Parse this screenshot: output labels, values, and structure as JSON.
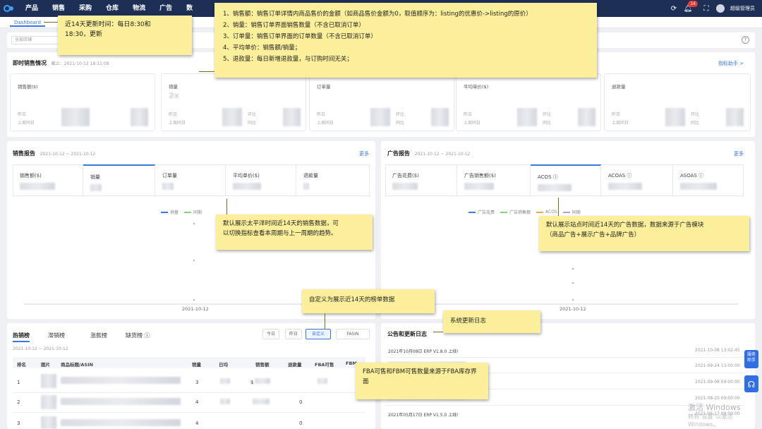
{
  "nav": {
    "items": [
      "产品",
      "销售",
      "采购",
      "仓库",
      "物流",
      "广告",
      "数"
    ],
    "badge": "14",
    "user": "超级管理员"
  },
  "tabbar": {
    "dashboard": "Dashboard"
  },
  "filter": {
    "store_placeholder": "全部店铺"
  },
  "realtime": {
    "title": "即时销售情况",
    "subtitle": "截止：2021-10-12 18:11:08",
    "more": "指标助手 >",
    "cards": [
      {
        "label": "销售额($)",
        "value": "",
        "l1": "昨日",
        "l2": "上周同日",
        "r1": "",
        "r2": ""
      },
      {
        "label": "销量",
        "value": "2x",
        "l1": "昨日",
        "l2": "上周同日",
        "r1": "环比",
        "r2": "同比"
      },
      {
        "label": "订单量",
        "value": "",
        "l1": "昨日",
        "l2": "上周同日",
        "r1": "环比",
        "r2": "同比"
      },
      {
        "label": "平均单价($)",
        "value": "",
        "l1": "昨日",
        "l2": "上周同日",
        "r1": "环比",
        "r2": "同比"
      },
      {
        "label": "退款量",
        "value": "",
        "l1": "昨日",
        "l2": "上周同日",
        "r1": "环比",
        "r2": "同比"
      }
    ]
  },
  "sales_report": {
    "title": "销售报告",
    "subtitle": "2021-10-12 ~ 2021-10-12",
    "more": "更多",
    "tabs": [
      "销售额($)",
      "销量",
      "订单量",
      "平均单价($)",
      "退款量"
    ],
    "legend": [
      "销量",
      "同期"
    ],
    "x_label": "2021-10-12"
  },
  "ad_report": {
    "title": "广告报告",
    "subtitle": "2021-10-12 ~ 2021-10-12",
    "more": "更多",
    "tabs": [
      "广告花费($)",
      "广告销售额($)",
      "ACOS ⓘ",
      "ACOAS ⓘ",
      "ASOAS ⓘ"
    ],
    "legend": [
      "广告花费",
      "广告销售额",
      "ACOS",
      "同期"
    ],
    "x_label": "2021-10-12"
  },
  "ranking": {
    "tabs": [
      "热销榜",
      "滞销榜",
      "涨款榜",
      "缺货榜 ⓘ"
    ],
    "date": "2021-10-12 ~ 2021-10-12",
    "buttons": [
      "今日",
      "昨日",
      "自定义",
      "FASIN"
    ],
    "columns": [
      "排名",
      "图片",
      "商品标题/ASIN",
      "销量",
      "日均",
      "销售额",
      "退款量",
      "FBA可售",
      "FBM"
    ],
    "rows": [
      {
        "rank": "1",
        "qty": "3",
        "amount": "$",
        "refund": "0"
      },
      {
        "rank": "2",
        "qty": "4",
        "amount": "",
        "refund": "0"
      },
      {
        "rank": "3",
        "qty": "4",
        "amount": "",
        "refund": "0"
      }
    ]
  },
  "announce": {
    "title": "公告和更新日志",
    "items": [
      {
        "text": "2021年10月08日 ERP V1.8.0 上线!",
        "date": "2021-10-08 13:02:45"
      },
      {
        "text": "",
        "date": "2021-09-24 13:00:00"
      },
      {
        "text": "",
        "date": "2021-09-08 09:00:00"
      },
      {
        "text": "",
        "date": "2021-08-20 09:00:00"
      },
      {
        "text": "2021年05月17日 ERP V1.5.0 上线!",
        "date": "2021-05-17 09:00:00"
      }
    ]
  },
  "float_buttons": [
    "服务助手",
    "在线客服"
  ],
  "watermark": {
    "line1": "激活 Windows",
    "line2": "转到\"设置\"以激活 Windows。"
  },
  "notes": {
    "update_time": [
      "近14天更新时间：每日8:30和",
      "18:30，更新"
    ],
    "definitions": [
      "1、销售额：销售订单详情内商品售价的金额（如商品售价金额为0，取值顺序为：listing的优惠价->listing的原价）",
      "2、销量：销售订单界面销售数量（不含已取消订单）",
      "3、订单量：销售订单界面的订单数量（不含已取消订单）",
      "4、平均单价：销售额/销量；",
      "5、退款量：每日新增退款量，与订购时间无关；"
    ],
    "sales_default": [
      "默认展示太平洋时间近14天的销售数据，可",
      "以切换指标查看本周期与上一周期的趋势。"
    ],
    "ad_default": [
      "默认展示站点时间近14天的广告数据，数据来源于广告模块",
      "（商品广告+展示广告+品牌广告）"
    ],
    "custom": [
      "自定义为展示近14天的榜单数据"
    ],
    "system_log": [
      "系统更新日志"
    ],
    "fba": [
      "FBA可售和FBM可售数量来源于FBA库存界",
      "面"
    ]
  }
}
